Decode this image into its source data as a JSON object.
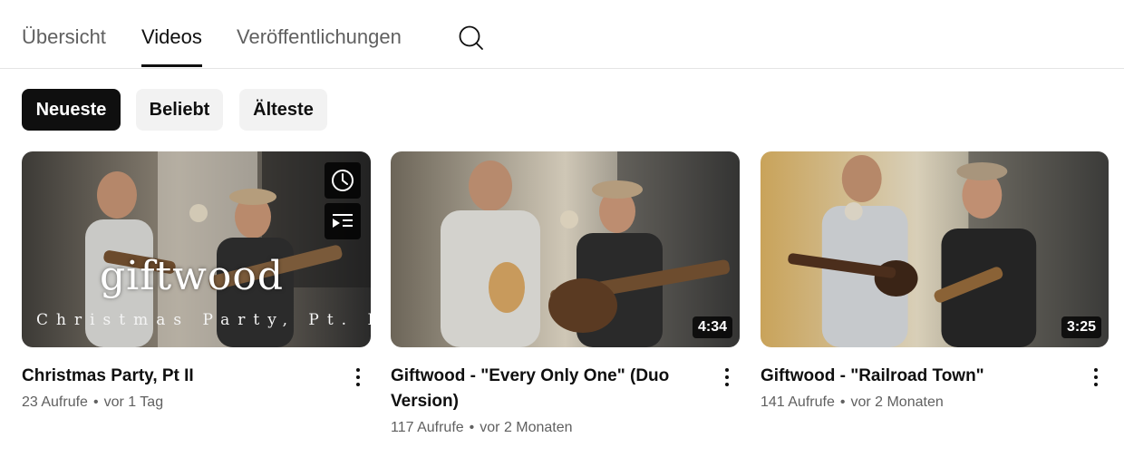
{
  "tabs": [
    {
      "label": "Übersicht"
    },
    {
      "label": "Videos",
      "active": true
    },
    {
      "label": "Veröffentlichungen"
    }
  ],
  "search_icon": "search-icon",
  "chips": [
    {
      "label": "Neueste",
      "selected": true
    },
    {
      "label": "Beliebt"
    },
    {
      "label": "Älteste"
    }
  ],
  "videos": [
    {
      "title": "Christmas Party, Pt II",
      "views": "23 Aufrufe",
      "age": "vor 1 Tag",
      "overlay_text": "giftwood",
      "overlay_subtitle": "Christmas Party, Pt. II",
      "hover_icons": [
        "clock-icon",
        "add-to-queue-icon"
      ]
    },
    {
      "title": "Giftwood - \"Every Only One\" (Duo Version)",
      "views": "117 Aufrufe",
      "age": "vor 2 Monaten",
      "duration": "4:34"
    },
    {
      "title": "Giftwood - \"Railroad Town\"",
      "views": "141 Aufrufe",
      "age": "vor 2 Monaten",
      "duration": "3:25"
    }
  ],
  "colors": {
    "text_primary": "#0f0f0f",
    "text_secondary": "#606060",
    "chip_bg": "#f2f2f2",
    "chip_selected_bg": "#0f0f0f"
  }
}
